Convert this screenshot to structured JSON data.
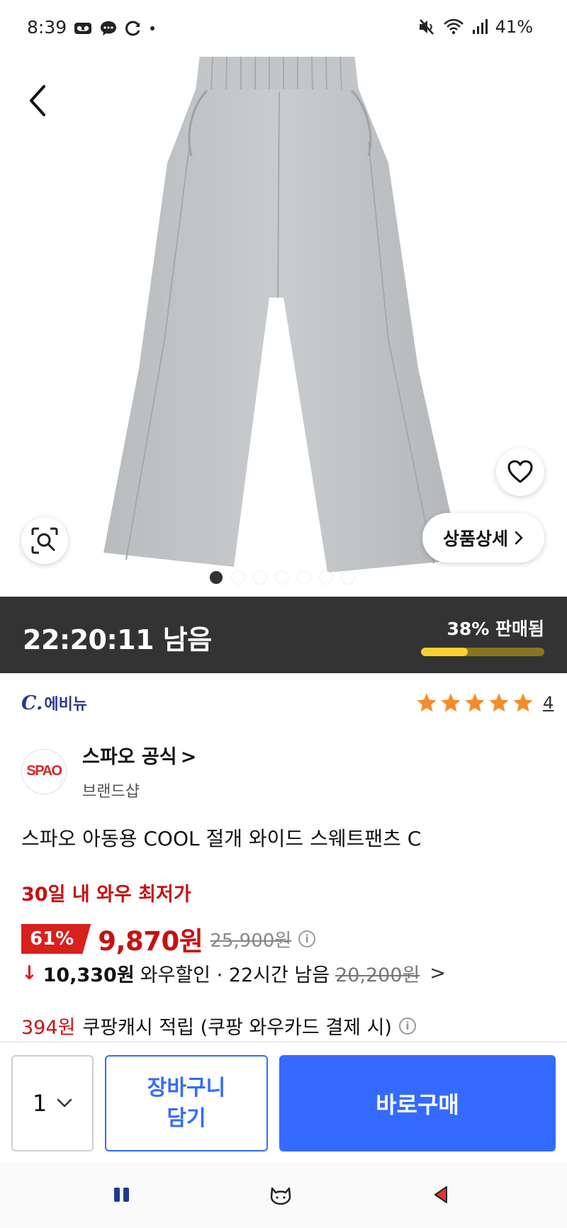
{
  "status_bar": {
    "time": "8:39",
    "battery": "41%",
    "left_icons": [
      "voicemail-icon",
      "chat-icon",
      "sync-icon",
      "dot-icon"
    ],
    "right_icons": [
      "mute-vibrate-icon",
      "wifi-icon",
      "signal-icon"
    ]
  },
  "hero": {
    "image_subject": "gray wide sweatpants",
    "detail_button": "상품상세",
    "dots_total": 7,
    "dots_active_index": 0
  },
  "timer": {
    "remaining": "22:20:11 남음",
    "sold_label": "38% 판매됨",
    "sold_fraction": 0.38
  },
  "review": {
    "brand_mark": "C.",
    "brand_name": "에비뉴",
    "stars": 5,
    "count": "4"
  },
  "seller": {
    "logo_text": "SPAO",
    "name": "스파오 공식",
    "chevron": ">",
    "type": "브랜드샵"
  },
  "product": {
    "title": "스파오 아동용 COOL 절개 와이드 스웨트팬츠 C"
  },
  "price": {
    "lowest_label": "30일 내 와우 최저가",
    "discount": "61%",
    "sale_price": "9,870원",
    "original_price": "25,900원",
    "info_icon": "i"
  },
  "wow": {
    "arrow": "↓",
    "price": "10,330원",
    "text": "와우할인 · 22시간 남음",
    "original": "20,200원",
    "chevron": ">"
  },
  "cash": {
    "amount": "394원",
    "text": "쿠팡캐시 적립 (쿠팡 와우카드 결제 시)",
    "info_icon": "i"
  },
  "action_bar": {
    "quantity": "1",
    "cart_button": "장바구니 담기",
    "buy_button": "바로구매"
  },
  "colors": {
    "accent_blue": "#346aff",
    "price_red": "#c81010",
    "timer_bg": "#333333",
    "progress_yellow": "#f7d22c",
    "star_orange": "#f58b2b"
  }
}
